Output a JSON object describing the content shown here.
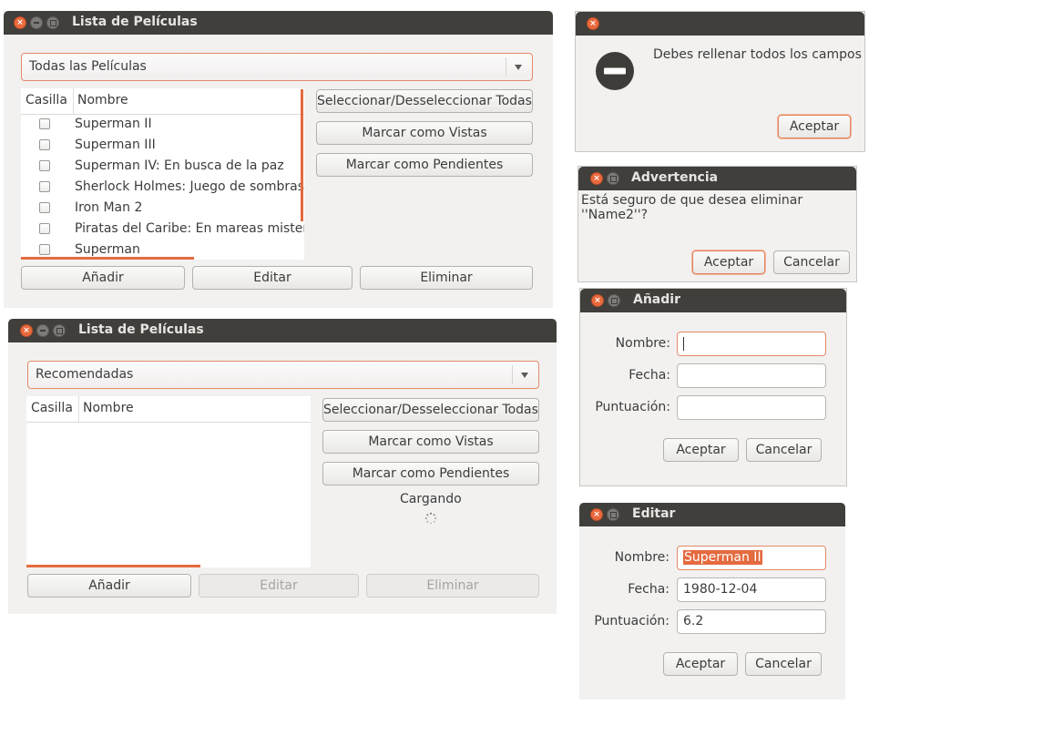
{
  "win1": {
    "title": "Lista de Películas",
    "combo": "Todas las Películas",
    "col_casilla": "Casilla",
    "col_nombre": "Nombre",
    "rows": [
      "Superman II",
      "Superman III",
      "Superman IV: En busca de la paz",
      "Sherlock Holmes: Juego de sombras",
      "Iron Man 2",
      "Piratas del Caribe: En mareas misteriosas",
      "Superman"
    ],
    "btn_select": "Seleccionar/Desseleccionar Todas",
    "btn_vistas": "Marcar como Vistas",
    "btn_pendientes": "Marcar como Pendientes",
    "btn_add": "Añadir",
    "btn_edit": "Editar",
    "btn_delete": "Eliminar"
  },
  "win2": {
    "title": "Lista de Películas",
    "combo": "Recomendadas",
    "col_casilla": "Casilla",
    "col_nombre": "Nombre",
    "btn_select": "Seleccionar/Desseleccionar Todas",
    "btn_vistas": "Marcar como Vistas",
    "btn_pendientes": "Marcar como Pendientes",
    "loading": "Cargando",
    "btn_add": "Añadir",
    "btn_edit": "Editar",
    "btn_delete": "Eliminar"
  },
  "error_dialog": {
    "message": "Debes rellenar todos los campos",
    "accept": "Aceptar"
  },
  "warning_dialog": {
    "title": "Advertencia",
    "message": "Está seguro de que desea eliminar ''Name2''?",
    "accept": "Aceptar",
    "cancel": "Cancelar"
  },
  "add_dialog": {
    "title": "Añadir",
    "label_nombre": "Nombre:",
    "label_fecha": "Fecha:",
    "label_puntuacion": "Puntuación:",
    "value_nombre": "",
    "value_fecha": "",
    "value_puntuacion": "",
    "accept": "Aceptar",
    "cancel": "Cancelar"
  },
  "edit_dialog": {
    "title": "Editar",
    "label_nombre": "Nombre:",
    "label_fecha": "Fecha:",
    "label_puntuacion": "Puntuación:",
    "value_nombre": "Superman II",
    "value_fecha": "1980-12-04",
    "value_puntuacion": "6.2",
    "accept": "Aceptar",
    "cancel": "Cancelar"
  },
  "colors": {
    "accent": "#e46a3f",
    "titlebar": "#403f3b",
    "window_bg": "#f2f1f0"
  }
}
